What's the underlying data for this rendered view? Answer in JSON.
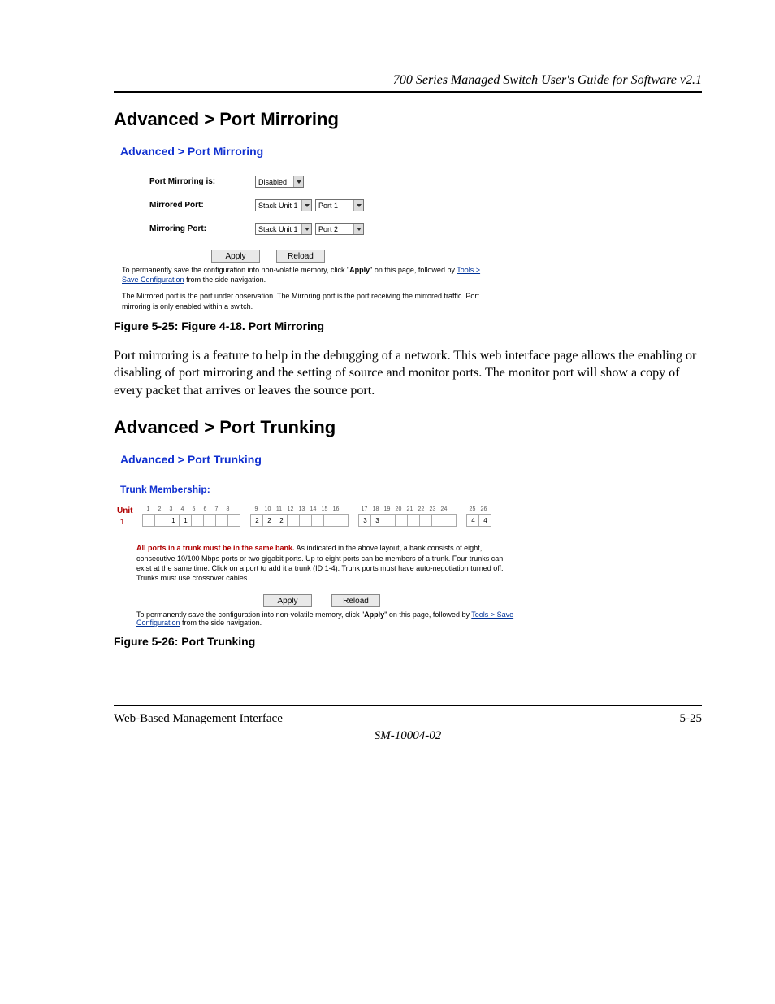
{
  "running_head": "700 Series Managed Switch User's Guide for Software v2.1",
  "section_mirroring": "Advanced > Port Mirroring",
  "mirroring_ui": {
    "title": "Advanced > Port Mirroring",
    "row_enable_label": "Port Mirroring is:",
    "row_enable_value": "Disabled",
    "row_mirrored_label": "Mirrored Port:",
    "row_mirrored_unit": "Stack Unit 1",
    "row_mirrored_port": "Port 1",
    "row_mirroring_label": "Mirroring Port:",
    "row_mirroring_unit": "Stack Unit 1",
    "row_mirroring_port": "Port 2",
    "btn_apply": "Apply",
    "btn_reload": "Reload",
    "save_note_pre": "To permanently save the configuration into non-volatile memory, click \"",
    "save_note_bold": "Apply",
    "save_note_post": "\" on this page, followed by ",
    "save_note_link": "Tools > Save Configuration",
    "save_note_tail": " from the side navigation.",
    "desc": "The Mirrored port is the port under observation. The Mirroring port is the port receiving the mirrored traffic. Port mirroring is only enabled within a switch."
  },
  "fig_mirroring": "Figure 5-25:  Figure 4-18. Port Mirroring",
  "body_mirroring": "Port mirroring is a feature to help in the debugging of a network.  This web interface page allows the enabling or disabling of port mirroring and the setting of source and monitor ports. The monitor port will show a copy of every packet that arrives or leaves the source port.",
  "section_trunking": "Advanced > Port Trunking",
  "trunking_ui": {
    "title": "Advanced > Port Trunking",
    "subtitle": "Trunk Membership:",
    "unit_head": "Unit",
    "unit_num": "1",
    "ports": [
      "1",
      "2",
      "3",
      "4",
      "5",
      "6",
      "7",
      "8",
      "9",
      "10",
      "11",
      "12",
      "13",
      "14",
      "15",
      "16",
      "17",
      "18",
      "19",
      "20",
      "21",
      "22",
      "23",
      "24",
      "25",
      "26"
    ],
    "cell_values": [
      "",
      "",
      "1",
      "1",
      "",
      "",
      "",
      "",
      "2",
      "2",
      "2",
      "",
      "",
      "",
      "",
      "",
      "3",
      "3",
      "",
      "",
      "",
      "",
      "",
      "",
      "4",
      "4"
    ],
    "note_lead": "All ports in a trunk must be in the same bank.",
    "note_rest": " As indicated in the above layout, a bank consists of eight, consecutive 10/100 Mbps ports or two gigabit ports. Up to eight ports can be members of a trunk. Four trunks can exist at the same time. Click on a port to add it a trunk (ID 1-4). Trunk ports must have auto-negotiation turned off. Trunks must use crossover cables.",
    "btn_apply": "Apply",
    "btn_reload": "Reload",
    "save_note_pre": "To permanently save the configuration into non-volatile memory, click \"",
    "save_note_bold": "Apply",
    "save_note_post": "\" on this page, followed by ",
    "save_note_link": "Tools > Save Configuration",
    "save_note_tail": " from the side navigation."
  },
  "fig_trunking": "Figure 5-26:  Port Trunking",
  "footer_left": "Web-Based Management Interface",
  "footer_right": "5-25",
  "doc_id": "SM-10004-02"
}
